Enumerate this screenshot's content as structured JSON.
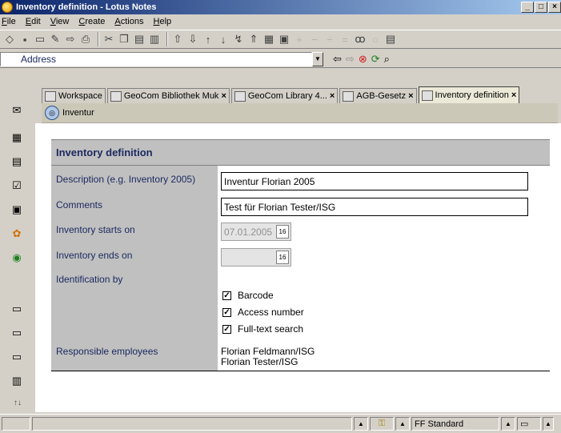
{
  "window": {
    "title": "Inventory definition - Lotus Notes",
    "minimize": "_",
    "maximize": "□",
    "close": "×"
  },
  "menu": [
    "File",
    "Edit",
    "View",
    "Create",
    "Actions",
    "Help"
  ],
  "address": {
    "label": "Address",
    "value": ""
  },
  "tabs": [
    {
      "label": "Workspace"
    },
    {
      "label": "GeoCom Bibliothek Muk"
    },
    {
      "label": "GeoCom Library 4..."
    },
    {
      "label": "AGB-Gesetz"
    },
    {
      "label": "Inventory definition"
    }
  ],
  "doc_header": {
    "title": "Inventur"
  },
  "form": {
    "title": "Inventory definition",
    "description": {
      "label": "Description (e.g. Inventory 2005)",
      "value": "Inventur Florian 2005"
    },
    "comments": {
      "label": "Comments",
      "value": "Test für Florian Tester/ISG"
    },
    "starts_on": {
      "label": "Inventory starts on",
      "value": "07.01.2005",
      "cal": "16"
    },
    "ends_on": {
      "label": "Inventory ends on",
      "value": "",
      "cal": "16"
    },
    "identification": {
      "label": "Identification by",
      "options": [
        {
          "label": "Barcode",
          "checked": true
        },
        {
          "label": "Access number",
          "checked": true
        },
        {
          "label": "Full-text search",
          "checked": true
        }
      ]
    },
    "responsible": {
      "label": "Responsible employees",
      "values": [
        "Florian Feldmann/ISG",
        "Florian Tester/ISG"
      ]
    }
  },
  "status": {
    "style": "FF Standard"
  }
}
